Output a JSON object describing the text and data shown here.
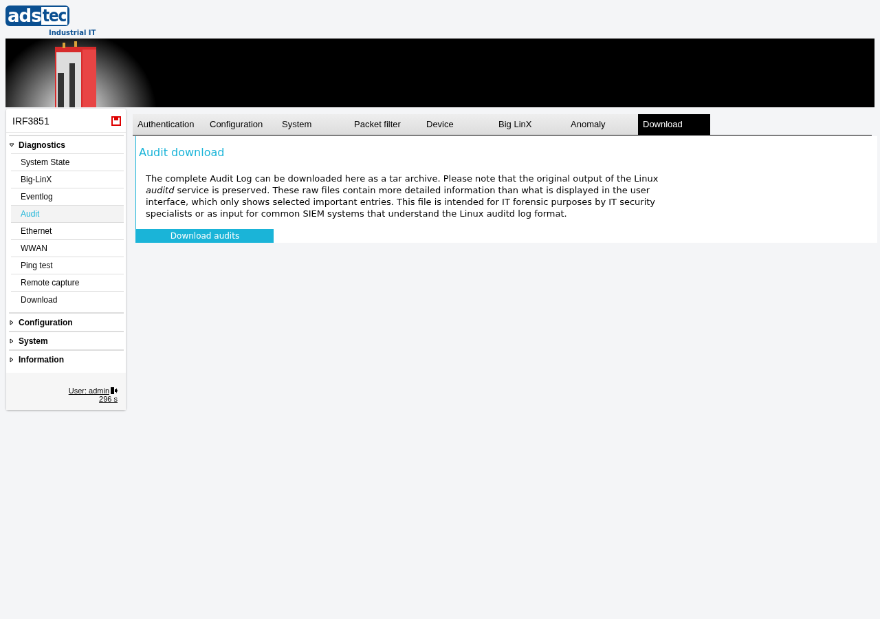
{
  "logo": {
    "part_1": "ads",
    "part_2": "tec",
    "tagline": "Industrial IT"
  },
  "sidebar": {
    "device": "IRF3851",
    "sections": [
      {
        "label": "Diagnostics",
        "expanded": true,
        "children": [
          {
            "label": "System State",
            "selected": false
          },
          {
            "label": "Big-LinX",
            "selected": false
          },
          {
            "label": "Eventlog",
            "selected": false
          },
          {
            "label": "Audit",
            "selected": true
          },
          {
            "label": "Ethernet",
            "selected": false
          },
          {
            "label": "WWAN",
            "selected": false
          },
          {
            "label": "Ping test",
            "selected": false
          },
          {
            "label": "Remote capture",
            "selected": false
          },
          {
            "label": "Download",
            "selected": false
          }
        ]
      },
      {
        "label": "Configuration",
        "expanded": false
      },
      {
        "label": "System",
        "expanded": false
      },
      {
        "label": "Information",
        "expanded": false
      }
    ],
    "user": "User: admin",
    "timer": "296 s"
  },
  "tabs": [
    {
      "label": "Authentication",
      "selected": false
    },
    {
      "label": "Configuration",
      "selected": false
    },
    {
      "label": "System",
      "selected": false
    },
    {
      "label": "Packet filter",
      "selected": false
    },
    {
      "label": "Device",
      "selected": false
    },
    {
      "label": "Big LinX",
      "selected": false
    },
    {
      "label": "Anomaly",
      "selected": false
    },
    {
      "label": "Download",
      "selected": true
    }
  ],
  "content": {
    "title": "Audit download",
    "text": "The complete Audit Log can be downloaded here as a tar archive. Please note that the original output of the Linux *auditd* service is preserved. These raw files contain more detailed information than what is displayed in the user interface, which only shows selected important entries. This file is intended for IT forensic purposes by IT security specialists or as input for common SIEM systems that understand the Linux auditd log format.",
    "button": "Download audits"
  }
}
